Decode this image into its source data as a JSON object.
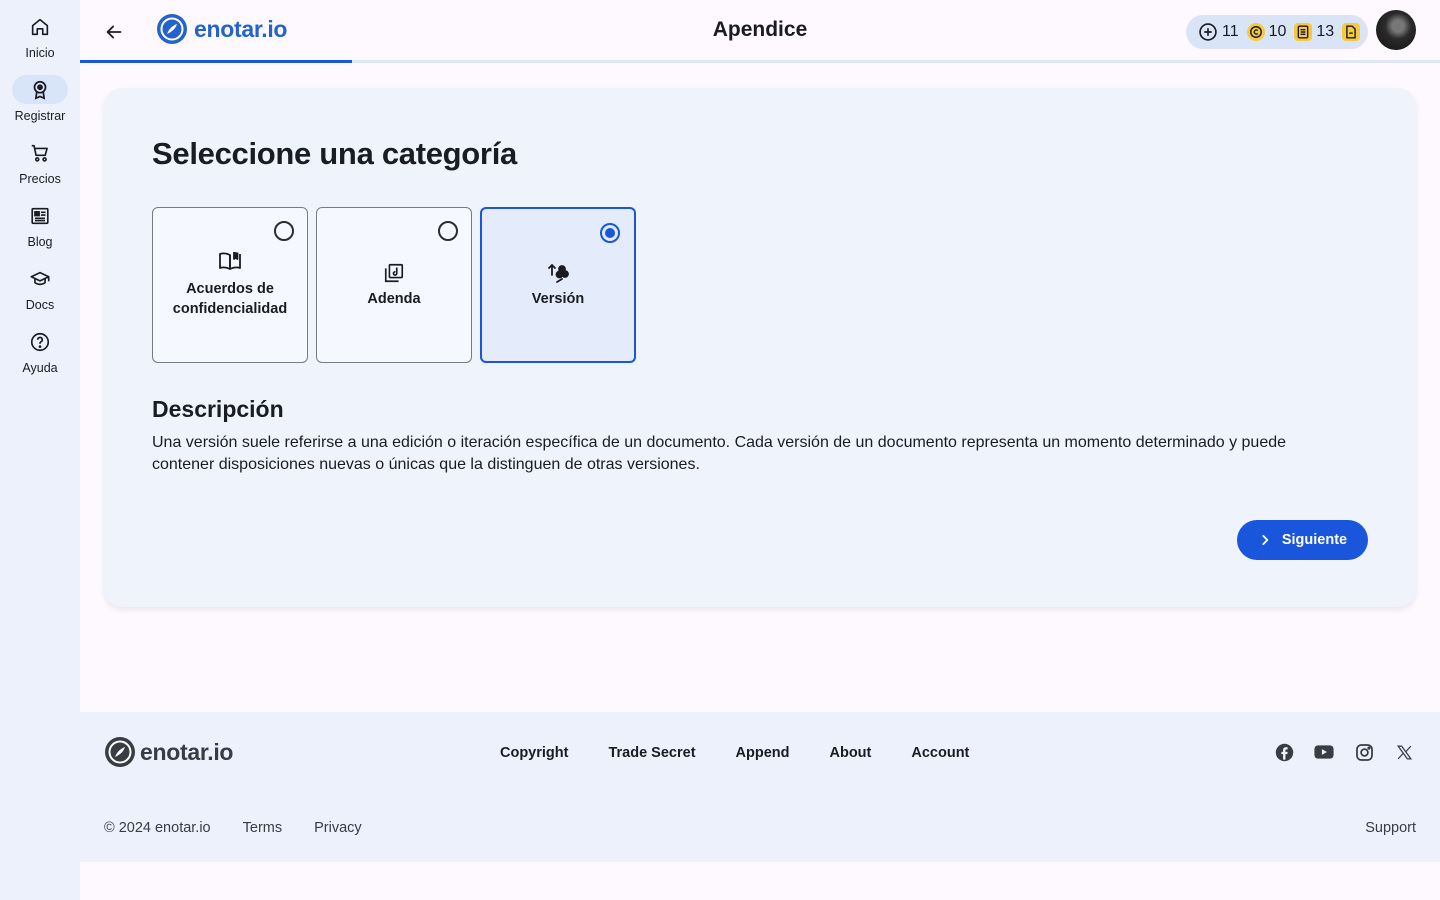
{
  "sidebar": {
    "items": [
      {
        "label": "Inicio",
        "icon": "home-icon"
      },
      {
        "label": "Registrar",
        "icon": "award-icon",
        "active": true
      },
      {
        "label": "Precios",
        "icon": "cart-icon"
      },
      {
        "label": "Blog",
        "icon": "newspaper-icon"
      },
      {
        "label": "Docs",
        "icon": "graduation-cap-icon"
      },
      {
        "label": "Ayuda",
        "icon": "help-circle-icon"
      }
    ]
  },
  "header": {
    "logo_text": "enotar.io",
    "title": "Apendice",
    "progress": 0.2,
    "credits": [
      {
        "icon": "add-credit-icon",
        "value": "11"
      },
      {
        "icon": "copyright-coin-icon",
        "value": "10"
      },
      {
        "icon": "document-coin-icon",
        "value": "13"
      },
      {
        "icon": "file-coin-icon",
        "value": ""
      }
    ]
  },
  "main": {
    "title": "Seleccione una categoría",
    "options": [
      {
        "label_line1": "Acuerdos de",
        "label_line2": "confidencialidad",
        "icon": "open-book-icon",
        "selected": false
      },
      {
        "label": "Adenda",
        "icon": "stacked-documents-icon",
        "selected": false
      },
      {
        "label": "Versión",
        "icon": "versions-icon",
        "selected": true
      }
    ],
    "description_title": "Descripción",
    "description": "Una versión suele referirse a una edición o iteración específica de un documento. Cada versión de un documento representa un momento determinado y puede contener disposiciones nuevas o únicas que la distinguen de otras versiones.",
    "next_label": "Siguiente"
  },
  "footer": {
    "logo_text": "enotar.io",
    "links": [
      "Copyright",
      "Trade Secret",
      "Append",
      "About",
      "Account"
    ],
    "social": [
      "facebook-icon",
      "youtube-icon",
      "instagram-icon",
      "x-icon"
    ],
    "copyright": "© 2024 enotar.io",
    "terms": "Terms",
    "privacy": "Privacy",
    "support": "Support"
  },
  "colors": {
    "accent": "#1a56db",
    "sidebar_bg": "#edf1fb",
    "card_bg": "#eef3fc",
    "coin": "#f6c945"
  }
}
